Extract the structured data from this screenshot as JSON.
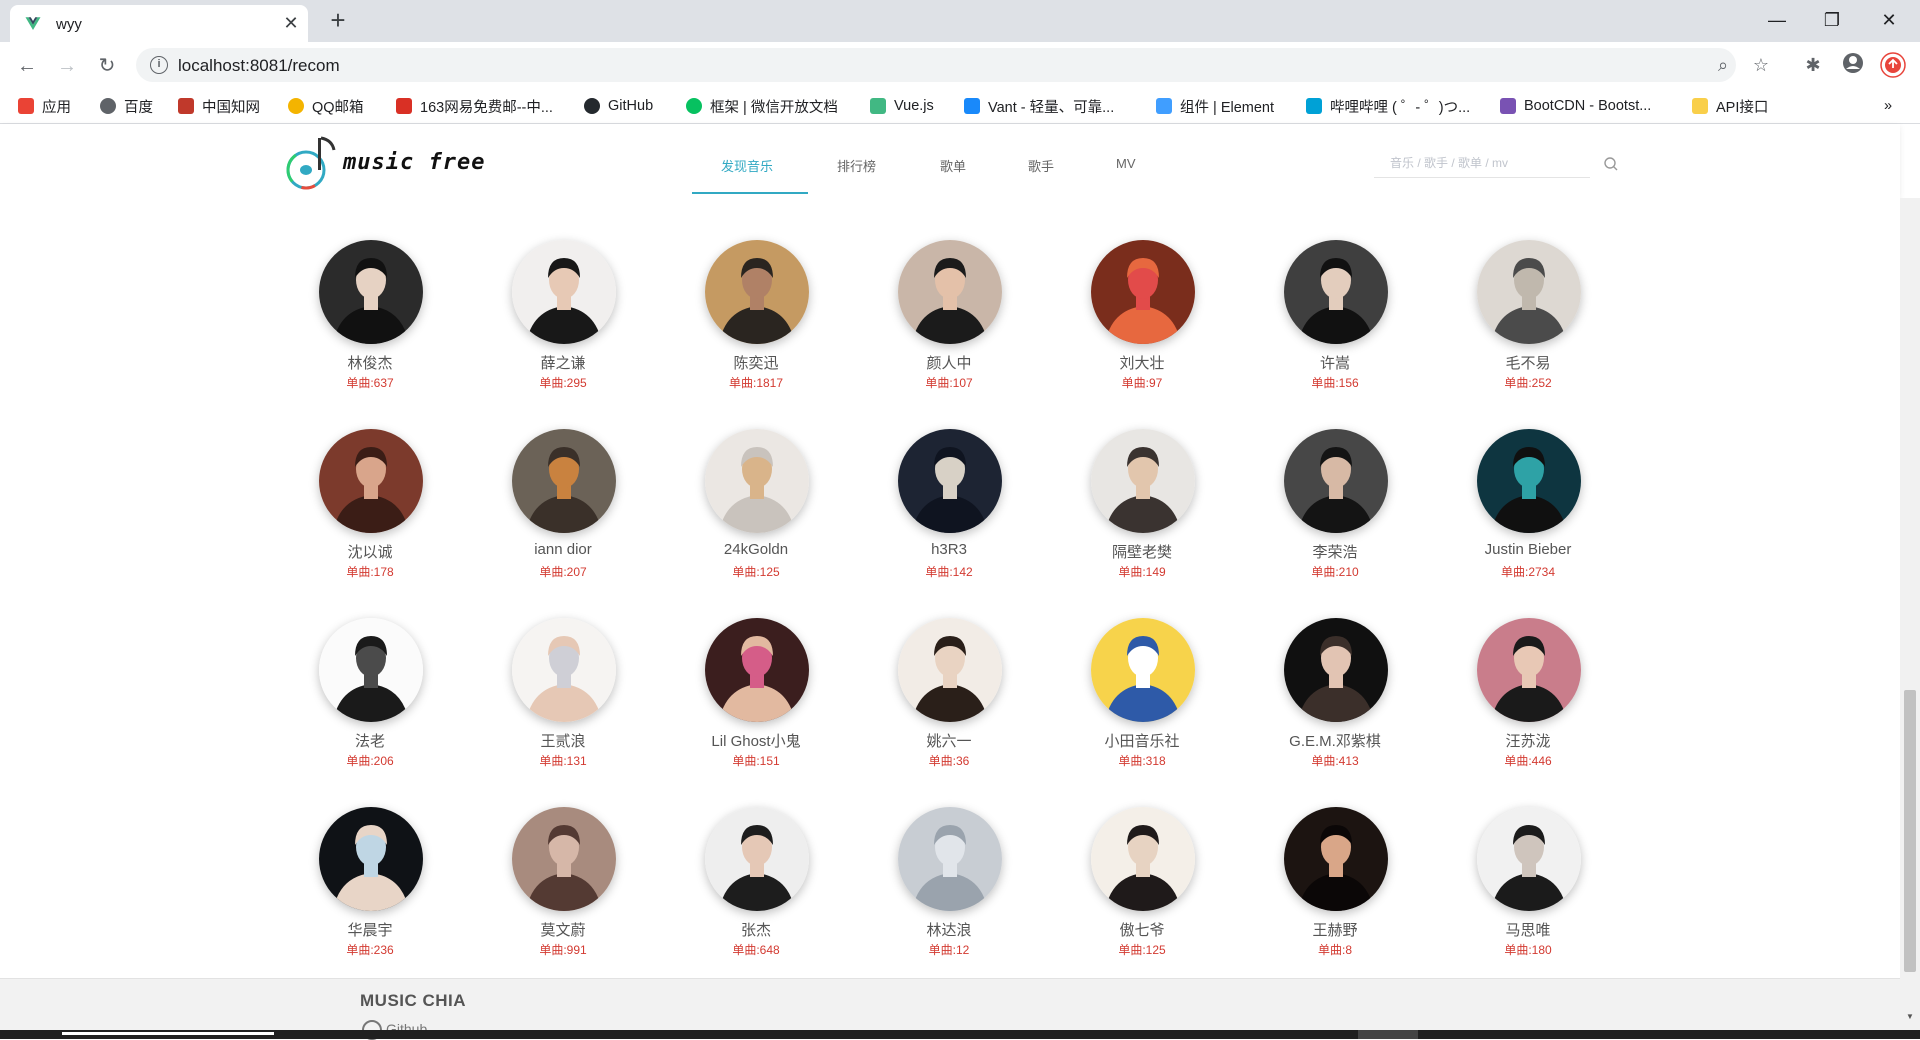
{
  "browser": {
    "tab_title": "wyy",
    "url_host": "localhost",
    "url_rest": ":8081/recom",
    "bookmarks": [
      {
        "label": "应用",
        "icon": "apps-grid-icon",
        "color": "#ea4335"
      },
      {
        "label": "百度",
        "icon": "globe-icon",
        "color": "#5f6368"
      },
      {
        "label": "中国知网",
        "icon": "cnki-icon",
        "color": "#c0392b"
      },
      {
        "label": "QQ邮箱",
        "icon": "qq-mail-icon",
        "color": "#f4b400"
      },
      {
        "label": "163网易免费邮--中...",
        "icon": "netease-icon",
        "color": "#d93025"
      },
      {
        "label": "GitHub",
        "icon": "github-icon",
        "color": "#24292e"
      },
      {
        "label": "框架 | 微信开放文档",
        "icon": "wechat-icon",
        "color": "#07c160"
      },
      {
        "label": "Vue.js",
        "icon": "vue-icon",
        "color": "#41b883"
      },
      {
        "label": "Vant - 轻量、可靠...",
        "icon": "vant-icon",
        "color": "#1989fa"
      },
      {
        "label": "组件 | Element",
        "icon": "element-icon",
        "color": "#409eff"
      },
      {
        "label": "哔哩哔哩 ( ゜- ゜)つ...",
        "icon": "bilibili-icon",
        "color": "#00a1d6"
      },
      {
        "label": "BootCDN - Bootst...",
        "icon": "bootcdn-icon",
        "color": "#7952b3"
      },
      {
        "label": "API接口",
        "icon": "folder-icon",
        "color": "#f9cf4a"
      }
    ]
  },
  "header": {
    "logo_text": "music free",
    "nav": [
      {
        "label": "发现音乐",
        "active": true
      },
      {
        "label": "排行榜",
        "active": false
      },
      {
        "label": "歌单",
        "active": false
      },
      {
        "label": "歌手",
        "active": false
      },
      {
        "label": "MV",
        "active": false
      }
    ],
    "search_placeholder": "音乐 / 歌手 / 歌单 / mv"
  },
  "artists": [
    {
      "name": "林俊杰",
      "count": "单曲:637",
      "palette": [
        "#2b2b2b",
        "#e6d2c3",
        "#111111"
      ]
    },
    {
      "name": "薛之谦",
      "count": "单曲:295",
      "palette": [
        "#f1efee",
        "#e7c9b5",
        "#181818"
      ]
    },
    {
      "name": "陈奕迅",
      "count": "单曲:1817",
      "palette": [
        "#c59a62",
        "#b08166",
        "#2a2520"
      ]
    },
    {
      "name": "颜人中",
      "count": "单曲:107",
      "palette": [
        "#c9b6a8",
        "#e4c1a9",
        "#1b1b1b"
      ]
    },
    {
      "name": "刘大壮",
      "count": "单曲:97",
      "palette": [
        "#7a2d1c",
        "#e24b4a",
        "#e7683f"
      ]
    },
    {
      "name": "许嵩",
      "count": "单曲:156",
      "palette": [
        "#3f3f3f",
        "#e3cdbd",
        "#111111"
      ]
    },
    {
      "name": "毛不易",
      "count": "单曲:252",
      "palette": [
        "#ddd8d2",
        "#c0b8ad",
        "#4b4b4b"
      ]
    },
    {
      "name": "沈以诚",
      "count": "单曲:178",
      "palette": [
        "#7c3a2c",
        "#d9a58b",
        "#3b1d16"
      ]
    },
    {
      "name": "iann dior",
      "count": "单曲:207",
      "palette": [
        "#6b6257",
        "#c9823f",
        "#3a3029"
      ]
    },
    {
      "name": "24kGoldn",
      "count": "单曲:125",
      "palette": [
        "#ebe7e3",
        "#d9b48a",
        "#c9c3bd"
      ]
    },
    {
      "name": "h3R3",
      "count": "单曲:142",
      "palette": [
        "#1d2433",
        "#d8d1c6",
        "#0f1420"
      ]
    },
    {
      "name": "隔壁老樊",
      "count": "单曲:149",
      "palette": [
        "#e8e6e3",
        "#e2c6ad",
        "#3a3330"
      ]
    },
    {
      "name": "李荣浩",
      "count": "单曲:210",
      "palette": [
        "#474747",
        "#d7b9a5",
        "#141414"
      ]
    },
    {
      "name": "Justin Bieber",
      "count": "单曲:2734",
      "palette": [
        "#0e3540",
        "#2ea2a6",
        "#101010"
      ]
    },
    {
      "name": "法老",
      "count": "单曲:206",
      "palette": [
        "#fbfbfb",
        "#4b4b4b",
        "#1a1a1a"
      ]
    },
    {
      "name": "王贰浪",
      "count": "单曲:131",
      "palette": [
        "#f6f4f2",
        "#cfcfd6",
        "#e6c8b5"
      ]
    },
    {
      "name": "Lil Ghost小鬼",
      "count": "单曲:151",
      "palette": [
        "#3b1e1e",
        "#d55d88",
        "#e2b9a0"
      ]
    },
    {
      "name": "姚六一",
      "count": "单曲:36",
      "palette": [
        "#f2ece6",
        "#e9d3c2",
        "#2a1f19"
      ]
    },
    {
      "name": "小田音乐社",
      "count": "单曲:318",
      "palette": [
        "#f7d34b",
        "#ffffff",
        "#2e5aa8"
      ]
    },
    {
      "name": "G.E.M.邓紫棋",
      "count": "单曲:413",
      "palette": [
        "#101010",
        "#e2c4b3",
        "#3b2f2a"
      ]
    },
    {
      "name": "汪苏泷",
      "count": "单曲:446",
      "palette": [
        "#c97d8b",
        "#e8c8b5",
        "#1a1a1a"
      ]
    },
    {
      "name": "华晨宇",
      "count": "单曲:236",
      "palette": [
        "#0f1216",
        "#bfd6e4",
        "#e8d5c7"
      ]
    },
    {
      "name": "莫文蔚",
      "count": "单曲:991",
      "palette": [
        "#a88b7e",
        "#d6b7a8",
        "#543a33"
      ]
    },
    {
      "name": "张杰",
      "count": "单曲:648",
      "palette": [
        "#eeeeee",
        "#e5c8b6",
        "#1d1d1d"
      ]
    },
    {
      "name": "林达浪",
      "count": "单曲:12",
      "palette": [
        "#c8cdd3",
        "#e1e5ea",
        "#9aa3ad"
      ]
    },
    {
      "name": "傲七爷",
      "count": "单曲:125",
      "palette": [
        "#f4efe8",
        "#e7d3c2",
        "#1f1a1a"
      ]
    },
    {
      "name": "王赫野",
      "count": "单曲:8",
      "palette": [
        "#1c1411",
        "#d9a688",
        "#0b0707"
      ]
    },
    {
      "name": "马思唯",
      "count": "单曲:180",
      "palette": [
        "#f1f1f1",
        "#cfc5bd",
        "#1b1b1b"
      ]
    }
  ],
  "footer": {
    "title": "MUSIC CHIA",
    "link": "Github"
  },
  "colors": {
    "accent": "#31a9c3",
    "count_red": "#d33a31"
  }
}
